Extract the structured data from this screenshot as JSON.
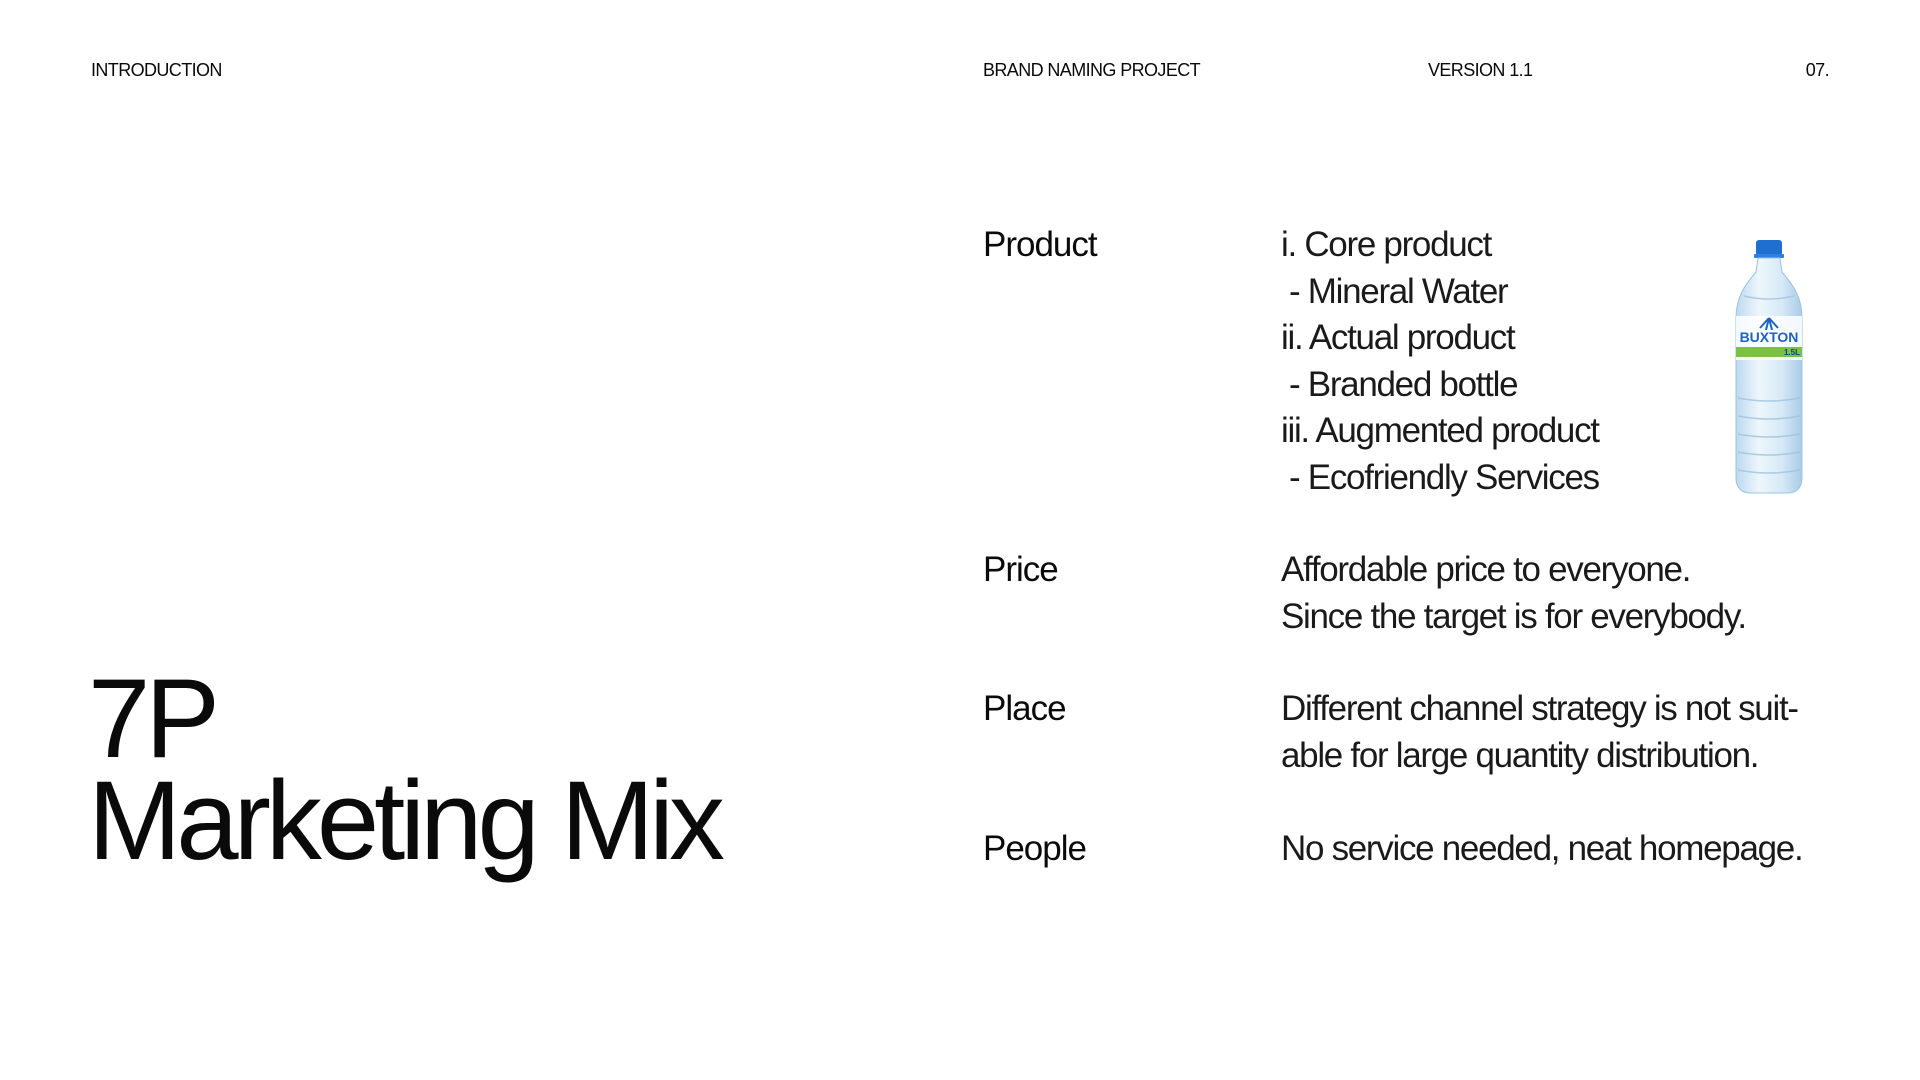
{
  "header": {
    "section": "INTRODUCTION",
    "project": "BRAND NAMING PROJECT",
    "version": "VERSION 1.1",
    "page": "07."
  },
  "title": {
    "line1": "7P",
    "line2": "Marketing Mix"
  },
  "mix": {
    "product": {
      "label": "Product",
      "lines": [
        "i. Core product",
        "- Mineral Water",
        "ii. Actual product",
        "- Branded bottle",
        "iii. Augmented product",
        "- Ecofriendly Services"
      ]
    },
    "price": {
      "label": "Price",
      "lines": [
        "Affordable price to everyone.",
        "Since the target is for everybody."
      ]
    },
    "place": {
      "label": "Place",
      "lines": [
        "Different channel strategy is not suit-",
        "able for large quantity distribution."
      ]
    },
    "people": {
      "label": "People",
      "lines": [
        "No service needed, neat homepage."
      ]
    }
  },
  "bottle_image": {
    "brand_text": "BUXTON",
    "volume_text": "1.5L",
    "cap_color": "#1f6fd1",
    "label_green": "#7cc242",
    "label_blue": "#1d63c2"
  }
}
